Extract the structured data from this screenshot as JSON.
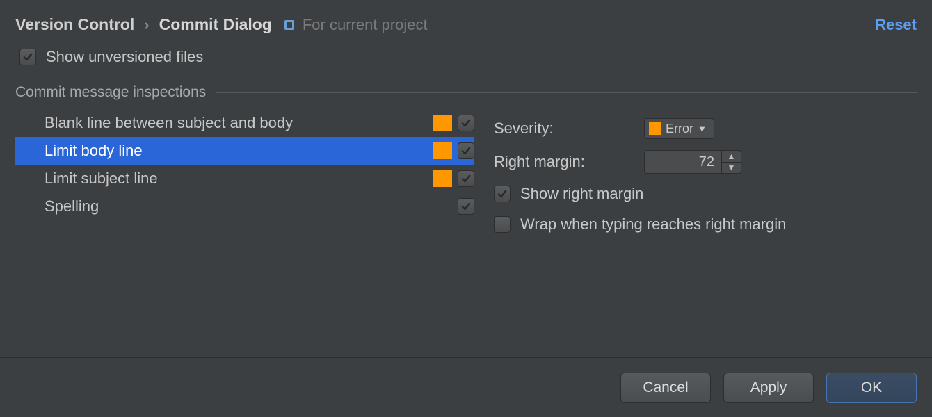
{
  "breadcrumb": {
    "parent": "Version Control",
    "current": "Commit Dialog",
    "scope": "For current project"
  },
  "reset_label": "Reset",
  "show_unversioned_label": "Show unversioned files",
  "section_title": "Commit message inspections",
  "inspections": [
    {
      "name": "Blank line between subject and body",
      "has_swatch": true,
      "checked": true,
      "selected": false
    },
    {
      "name": "Limit body line",
      "has_swatch": true,
      "checked": true,
      "selected": true
    },
    {
      "name": "Limit subject line",
      "has_swatch": true,
      "checked": true,
      "selected": false
    },
    {
      "name": "Spelling",
      "has_swatch": false,
      "checked": true,
      "selected": false
    }
  ],
  "details": {
    "severity_label": "Severity:",
    "severity_value": "Error",
    "right_margin_label": "Right margin:",
    "right_margin_value": "72",
    "show_right_margin_label": "Show right margin",
    "show_right_margin_checked": true,
    "wrap_label": "Wrap when typing reaches right margin",
    "wrap_checked": false
  },
  "buttons": {
    "cancel": "Cancel",
    "apply": "Apply",
    "ok": "OK"
  },
  "colors": {
    "selection": "#2b66d8",
    "swatch": "#ff9800",
    "link": "#5a9ff3"
  }
}
